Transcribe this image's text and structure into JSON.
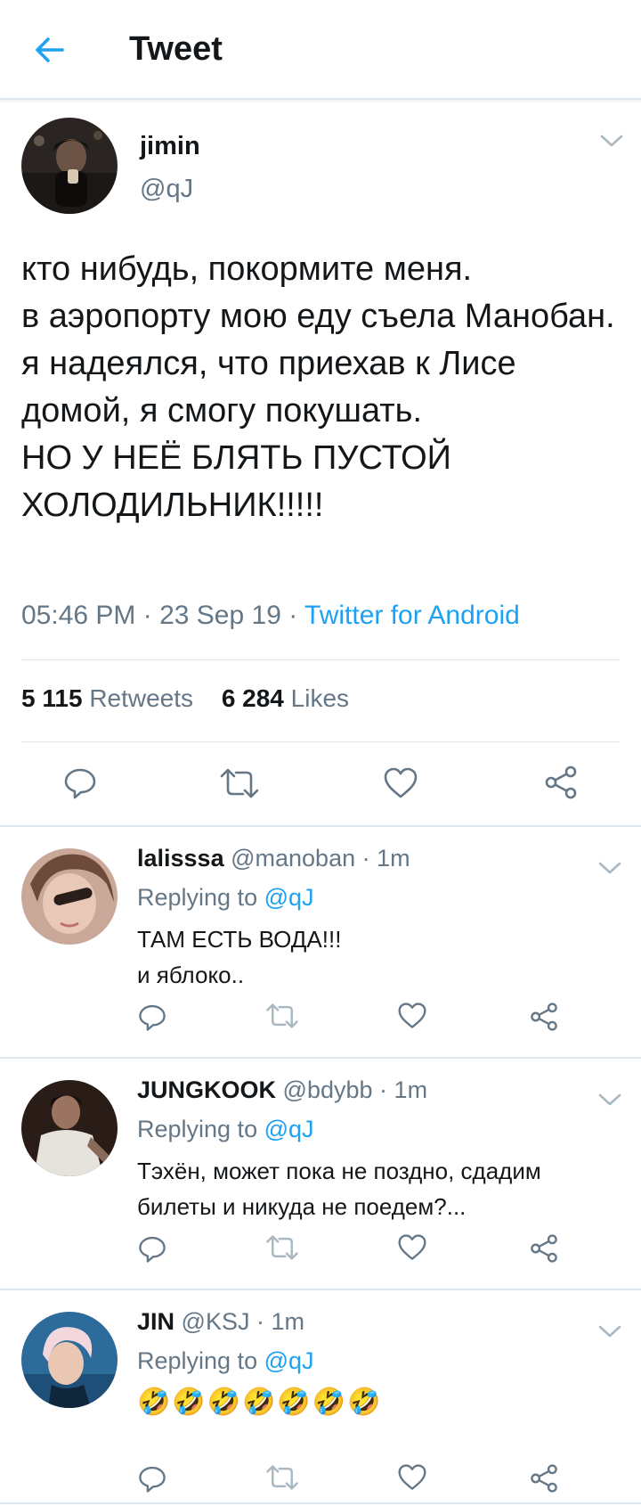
{
  "header": {
    "title": "Tweet",
    "back_icon": "arrow-left-icon",
    "accent": "#1da1f2"
  },
  "tweet": {
    "name": "jimin",
    "handle": "@qJ",
    "text": "кто нибудь, покормите меня.\nв аэропорту мою еду съела Манобан.\nя надеялся, что приехав к Лисе домой, я смогу покушать.\nНО У НЕЁ БЛЯТЬ ПУСТОЙ ХОЛОДИЛЬНИК!!!!!",
    "time": "05:46 PM",
    "date": "23 Sep 19",
    "source": "Twitter for Android",
    "retweets": "5 115",
    "retweets_label": "Retweets",
    "likes": "6 284",
    "likes_label": "Likes"
  },
  "replies": [
    {
      "name": "lalisssa",
      "handle": "@manoban",
      "time": "1m",
      "replying_label": "Replying to",
      "replying_to": "@qJ",
      "text": "ТАМ ЕСТЬ ВОДА!!!\nи яблоко.."
    },
    {
      "name": "JUNGKOOK",
      "handle": "@bdybb",
      "time": "1m",
      "replying_label": "Replying to",
      "replying_to": "@qJ",
      "text": "Тэхён, может пока не поздно, сдадим билеты и никуда не поедем?..."
    },
    {
      "name": "JIN",
      "handle": "@KSJ",
      "time": "1m",
      "replying_label": "Replying to",
      "replying_to": "@qJ",
      "text": "🤣🤣🤣🤣🤣🤣🤣"
    }
  ],
  "actions": [
    "reply-icon",
    "retweet-icon",
    "like-icon",
    "share-icon"
  ]
}
